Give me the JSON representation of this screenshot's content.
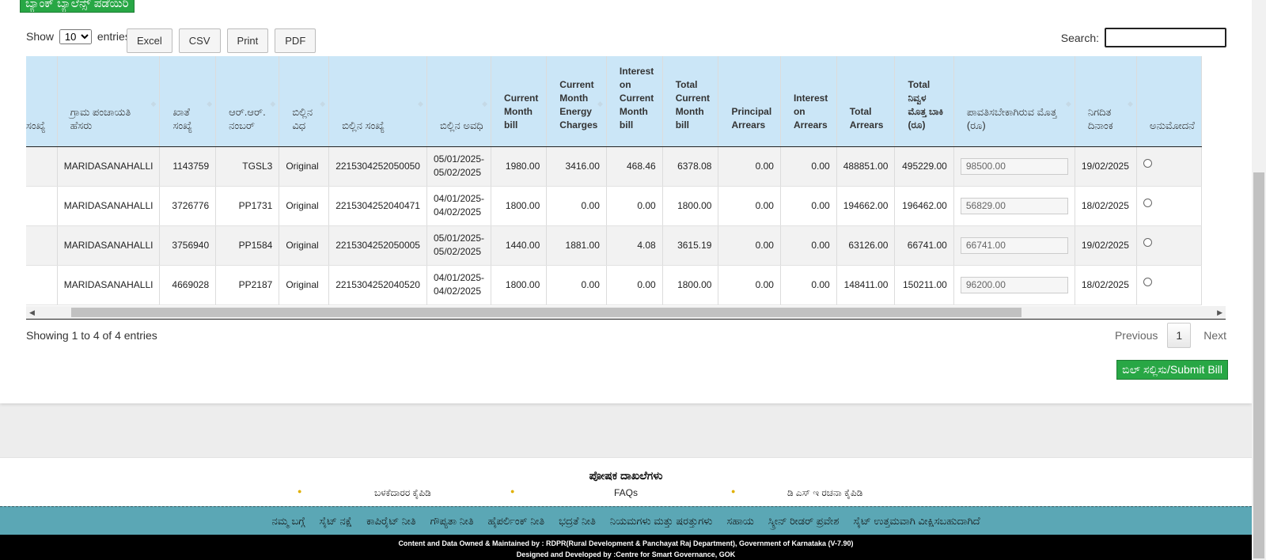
{
  "top_button_label": "ಬ್ಯಾಂಕ್ ಬ್ಯಾಲೆನ್ಸ್ ಪಡೆಯಿರಿ",
  "length_menu": {
    "prefix": "Show",
    "selected": "10",
    "suffix": "entries"
  },
  "export_buttons": [
    "Excel",
    "CSV",
    "Print",
    "PDF"
  ],
  "search": {
    "label": "Search:",
    "value": ""
  },
  "table": {
    "columns": [
      "ಸಂಖ್ಯೆ",
      "ಗ್ರಾಮ ಪಂಚಾಯತಿ ಹೆಸರು",
      "ಖಾತೆ ಸಂಖ್ಯೆ",
      "ಆರ್.ಆರ್. ನಂಬರ್",
      "ಬಿಲ್ಲಿನ ವಿಧ",
      "ಬಿಲ್ಲಿನ ಸಂಖ್ಯೆ",
      "ಬಿಲ್ಲಿನ ಅವಧಿ",
      "Current Month bill",
      "Current Month Energy Charges",
      "Interest on Current Month bill",
      "Total Current Month bill",
      "Principal Arrears",
      "Interest on Arrears",
      "Total Arrears",
      "Total ನಿವ್ವಳ ಮೊತ್ತ ಬಾಕಿ (ರೂ)",
      "ಪಾವತಿಸಬೇಕಾಗಿರುವ ಮೊತ್ತ (ರೂ)",
      "ನಿಗದಿತ ದಿನಾಂಕ",
      "ಅನುಮೋದನೆ"
    ],
    "rows": [
      {
        "gp": "MARIDASANAHALLI",
        "account": "1143759",
        "rr": "TGSL3",
        "type": "Original",
        "bill_no": "2215304252050050",
        "period_from": "05/01/2025-",
        "period_to": "05/02/2025",
        "cur_bill": "1980.00",
        "energy": "3416.00",
        "interest_cur": "468.46",
        "total_cur": "6378.08",
        "principal_arrears": "0.00",
        "interest_arrears": "0.00",
        "total_arrears": "488851.00",
        "net_due": "495229.00",
        "payable": "98500.00",
        "due_date": "19/02/2025"
      },
      {
        "gp": "MARIDASANAHALLI",
        "account": "3726776",
        "rr": "PP1731",
        "type": "Original",
        "bill_no": "2215304252040471",
        "period_from": "04/01/2025-",
        "period_to": "04/02/2025",
        "cur_bill": "1800.00",
        "energy": "0.00",
        "interest_cur": "0.00",
        "total_cur": "1800.00",
        "principal_arrears": "0.00",
        "interest_arrears": "0.00",
        "total_arrears": "194662.00",
        "net_due": "196462.00",
        "payable": "56829.00",
        "due_date": "18/02/2025"
      },
      {
        "gp": "MARIDASANAHALLI",
        "account": "3756940",
        "rr": "PP1584",
        "type": "Original",
        "bill_no": "2215304252050005",
        "period_from": "05/01/2025-",
        "period_to": "05/02/2025",
        "cur_bill": "1440.00",
        "energy": "1881.00",
        "interest_cur": "4.08",
        "total_cur": "3615.19",
        "principal_arrears": "0.00",
        "interest_arrears": "0.00",
        "total_arrears": "63126.00",
        "net_due": "66741.00",
        "payable": "66741.00",
        "due_date": "19/02/2025"
      },
      {
        "gp": "MARIDASANAHALLI",
        "account": "4669028",
        "rr": "PP2187",
        "type": "Original",
        "bill_no": "2215304252040520",
        "period_from": "04/01/2025-",
        "period_to": "04/02/2025",
        "cur_bill": "1800.00",
        "energy": "0.00",
        "interest_cur": "0.00",
        "total_cur": "1800.00",
        "principal_arrears": "0.00",
        "interest_arrears": "0.00",
        "total_arrears": "148411.00",
        "net_due": "150211.00",
        "payable": "96200.00",
        "due_date": "18/02/2025"
      }
    ]
  },
  "info": "Showing 1 to 4 of 4 entries",
  "pagination": {
    "previous": "Previous",
    "current": "1",
    "next": "Next"
  },
  "submit_label": "ಬಿಲ್ ಸಲ್ಲಿಸು/Submit Bill",
  "footer": {
    "title": "ಪೋಷಕ ದಾಖಲೆಗಳು",
    "links": [
      "ಬಳಕೆದಾರರ ಕೈಪಿಡಿ",
      "FAQs",
      "ಡಿ ಎಸ್ ಇ ರಚನಾ ಕೈಪಿಡಿ"
    ],
    "nav": [
      "ನಮ್ಮ ಬಗ್ಗೆ",
      "ಸೈಟ್ ನಕ್ಷೆ",
      "ಕಾಪಿರೈಟ್ ನೀತಿ",
      "ಗೌಪ್ಯತಾ ನೀತಿ",
      "ಹೈಪರ್ಲಿಂಕ್ ನೀತಿ",
      "ಭದ್ರತೆ ನೀತಿ",
      "ನಿಯಮಗಳು ಮತ್ತು ಷರತ್ತುಗಳು",
      "ಸಹಾಯ",
      "ಸ್ಕ್ರೀನ್ ರೀಡರ್ ಪ್ರವೇಶ",
      "ಸೈಟ್ ಉತ್ತಮವಾಗಿ ವೀಕ್ಷಿಸಬಹುದಾಗಿದೆ"
    ],
    "credits_line1": "Content and Data Owned & Maintained by : RDPR(Rural Development & Panchayat Raj Department), Government of Karnataka (V-7.90)",
    "credits_line2": "Designed and Developed by :Centre for Smart Governance, GOK"
  },
  "colors": {
    "accent_green": "#28a745",
    "header_blue": "#cbe6f7",
    "footer_teal": "#5ba7b5"
  }
}
